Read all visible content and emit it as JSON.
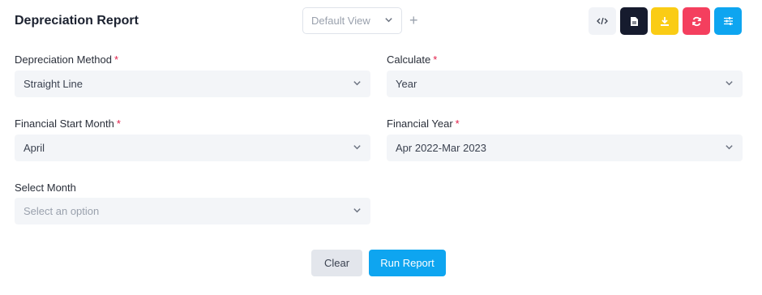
{
  "header": {
    "title": "Depreciation Report",
    "view_select": {
      "value": "Default View"
    },
    "add_view_glyph": "+"
  },
  "toolbar": [
    {
      "name": "code-view-button",
      "icon": "code-icon",
      "bg": "#f1f3f7",
      "fg": "#3b4250"
    },
    {
      "name": "pdf-export-button",
      "icon": "document-icon",
      "bg": "#161b2e",
      "fg": "#ffffff"
    },
    {
      "name": "download-button",
      "icon": "download-icon",
      "bg": "#facc15",
      "fg": "#ffffff"
    },
    {
      "name": "refresh-button",
      "icon": "refresh-icon",
      "bg": "#f43f5e",
      "fg": "#ffffff"
    },
    {
      "name": "filter-settings-button",
      "icon": "sliders-icon",
      "bg": "#0ea5f0",
      "fg": "#ffffff"
    }
  ],
  "form": {
    "depreciation_method": {
      "label": "Depreciation Method",
      "required_mark": "*",
      "value": "Straight Line"
    },
    "calculate": {
      "label": "Calculate",
      "required_mark": "*",
      "value": "Year"
    },
    "financial_start_month": {
      "label": "Financial Start Month",
      "required_mark": "*",
      "value": "April"
    },
    "financial_year": {
      "label": "Financial Year",
      "required_mark": "*",
      "value": "Apr 2022-Mar 2023"
    },
    "select_month": {
      "label": "Select Month",
      "placeholder": "Select an option"
    }
  },
  "actions": {
    "clear_label": "Clear",
    "run_label": "Run Report"
  },
  "colors": {
    "required": "#e11d48",
    "primary": "#0ea5f0",
    "field_bg": "#f3f5f8"
  }
}
